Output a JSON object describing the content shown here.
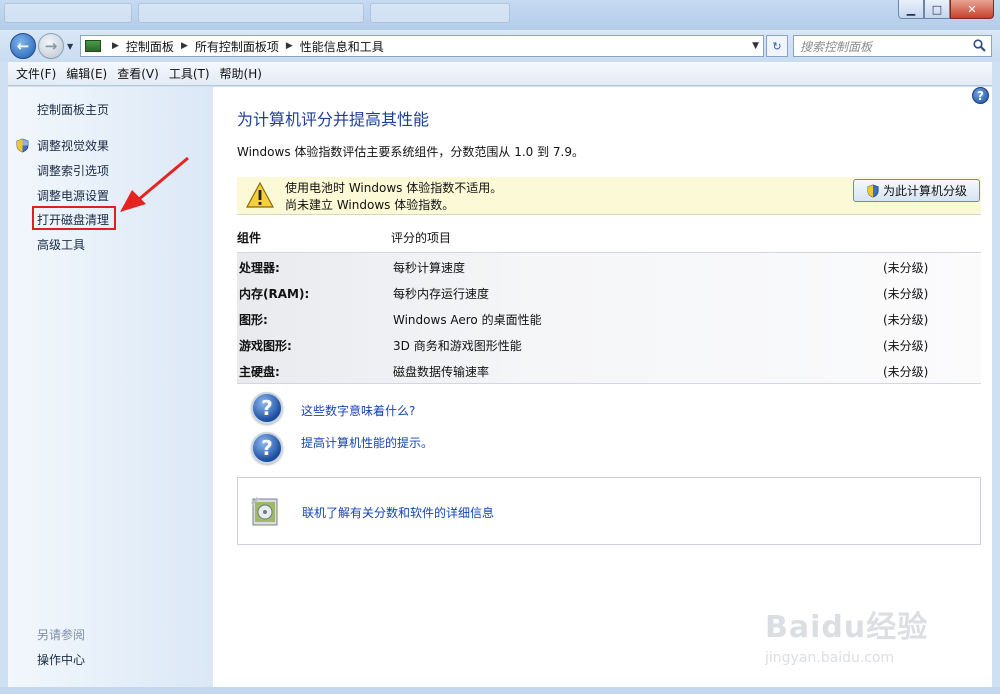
{
  "window": {
    "controls": {
      "minimize": "▁",
      "maximize": "□",
      "close": "✕"
    }
  },
  "address": {
    "crumbs": [
      "控制面板",
      "所有控制面板项",
      "性能信息和工具"
    ],
    "search_placeholder": "搜索控制面板"
  },
  "menu": [
    "文件(F)",
    "编辑(E)",
    "查看(V)",
    "工具(T)",
    "帮助(H)"
  ],
  "sidebar": {
    "home": "控制面板主页",
    "links": [
      "调整视觉效果",
      "调整索引选项",
      "调整电源设置",
      "打开磁盘清理",
      "高级工具"
    ],
    "see_also_title": "另请参阅",
    "see_also_links": [
      "操作中心"
    ]
  },
  "main": {
    "title": "为计算机评分并提高其性能",
    "description": "Windows 体验指数评估主要系统组件，分数范围从 1.0 到 7.9。",
    "warning": {
      "line1": "使用电池时 Windows 体验指数不适用。",
      "line2": "尚未建立 Windows 体验指数。",
      "button": "为此计算机分级"
    },
    "table": {
      "headers": [
        "组件",
        "评分的项目"
      ],
      "rows": [
        {
          "component": "处理器:",
          "item": "每秒计算速度",
          "score": "(未分级)"
        },
        {
          "component": "内存(RAM):",
          "item": "每秒内存运行速度",
          "score": "(未分级)"
        },
        {
          "component": "图形:",
          "item": "Windows Aero 的桌面性能",
          "score": "(未分级)"
        },
        {
          "component": "游戏图形:",
          "item": "3D 商务和游戏图形性能",
          "score": "(未分级)"
        },
        {
          "component": "主硬盘:",
          "item": "磁盘数据传输速率",
          "score": "(未分级)"
        }
      ]
    },
    "links": [
      "这些数字意味着什么?",
      "提高计算机性能的提示。"
    ],
    "info_link": "联机了解有关分数和软件的详细信息"
  },
  "watermark": {
    "text": "Baidu经验",
    "sub": "jingyan.baidu.com"
  }
}
